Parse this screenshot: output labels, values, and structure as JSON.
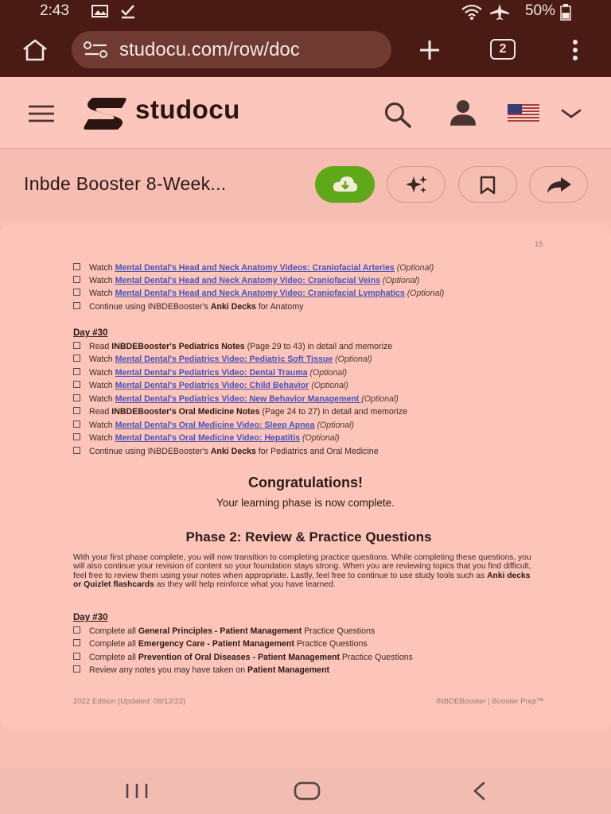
{
  "status_bar": {
    "time": "2:43",
    "battery": "50%"
  },
  "browser": {
    "url": "studocu.com/row/doc",
    "tab_count": "2"
  },
  "header": {
    "brand": "studocu"
  },
  "document": {
    "title": "Inbde Booster 8-Week...",
    "page_number": "15",
    "anatomy_items": [
      {
        "prefix": "Watch ",
        "link": "Mental Dental's Head and Neck Anatomy Videos: Craniofacial Arteries",
        "optional": "(Optional)"
      },
      {
        "prefix": "Watch ",
        "link": "Mental Dental's Head and Neck Anatomy Video: Craniofacial Veins",
        "optional": "(Optional)"
      },
      {
        "prefix": "Watch ",
        "link": "Mental Dental's Head and Neck Anatomy Video: Craniofacial Lymphatics",
        "optional": "(Optional)"
      },
      {
        "prefix": "Continue using INBDEBooster's ",
        "bold": "Anki Decks",
        "suffix": " for Anatomy"
      }
    ],
    "day30_heading": "Day #30",
    "day30_items": [
      {
        "prefix": "Read ",
        "bold": "INBDEBooster's Pediatrics Notes",
        "suffix": " (Page 29 to 43) in detail and memorize"
      },
      {
        "prefix": "Watch ",
        "link": "Mental Dental's Pediatrics Video: Pediatric Soft Tissue",
        "optional": "(Optional)"
      },
      {
        "prefix": "Watch ",
        "link": "Mental Dental's Pediatrics Video: Dental Trauma",
        "optional": "(Optional)"
      },
      {
        "prefix": "Watch ",
        "link": "Mental Dental's Pediatrics Video: Child Behavior",
        "optional": "(Optional)"
      },
      {
        "prefix": "Watch ",
        "link": "Mental Dental's Pediatrics Video: New Behavior Management ",
        "optional": "(Optional)"
      },
      {
        "prefix": "Read ",
        "bold": "INBDEBooster's Oral Medicine Notes",
        "suffix": " (Page 24 to 27) in detail and memorize"
      },
      {
        "prefix": "Watch ",
        "link": "Mental Dental's Oral Medicine Video: Sleep Apnea",
        "optional": "(Optional)"
      },
      {
        "prefix": "Watch ",
        "link": "Mental Dental's Oral Medicine Video: Hepatitis",
        "optional": "(Optional)"
      },
      {
        "prefix": "Continue using INBDEBooster's ",
        "bold": "Anki Decks",
        "suffix": " for Pediatrics and Oral Medicine"
      }
    ],
    "congrats_title": "Congratulations!",
    "congrats_sub": "Your learning phase is now complete.",
    "phase2_title": "Phase 2: Review & Practice Questions",
    "phase2_paragraph": {
      "p1": "With your first phase complete, you will now transition to completing practice questions. While completing these questions, you will also continue your revision of content so your foundation stays strong. When you are reviewing topics that you find difficult, feel free to review them using your notes when appropriate. Lastly, feel free to continue to use study tools such as ",
      "b1": "Anki decks or Quizlet flashcards",
      "p2": " as they will help reinforce what you have learned."
    },
    "day30b_heading": "Day #30",
    "day30b_items": [
      {
        "prefix": "Complete all ",
        "bold": "General Principles - Patient Management",
        "suffix": " Practice Questions"
      },
      {
        "prefix": "Complete all ",
        "bold": "Emergency Care - Patient Management",
        "suffix": " Practice Questions"
      },
      {
        "prefix": "Complete all ",
        "bold": "Prevention of Oral Diseases - Patient Management",
        "suffix": " Practice Questions"
      },
      {
        "prefix": "Review any notes you may have taken on ",
        "bold": "Patient Management",
        "suffix": ""
      }
    ],
    "footer_left": "2022 Edition (Updated: 08/12/22)",
    "footer_right": "INBDEBooster | Booster Prep™"
  },
  "colors": {
    "maroon": "#4a1a14",
    "header_bg": "#fcc6bc",
    "download_green": "#5ea81a",
    "link_blue": "#4a52b8",
    "page_bg": "#fdc4b9"
  }
}
